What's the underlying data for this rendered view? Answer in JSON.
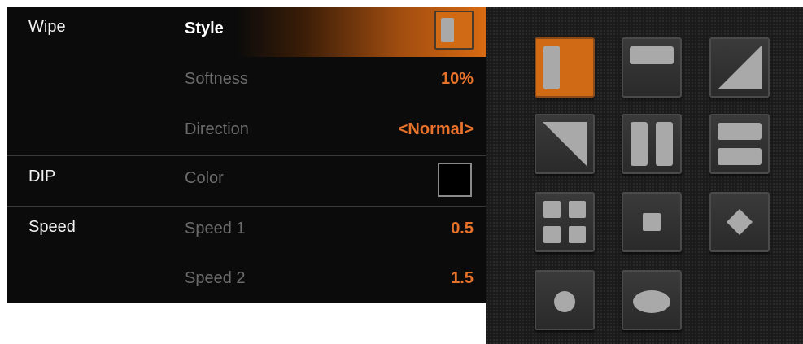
{
  "menu": {
    "rows": [
      {
        "category": "Wipe",
        "param": "Style",
        "value": "",
        "active": true
      },
      {
        "category": "",
        "param": "Softness",
        "value": "10%"
      },
      {
        "category": "",
        "param": "Direction",
        "value": "<Normal>"
      },
      {
        "category": "DIP",
        "param": "Color",
        "value": "",
        "swatch_color": "#000000"
      },
      {
        "category": "Speed",
        "param": "Speed 1",
        "value": "0.5"
      },
      {
        "category": "",
        "param": "Speed 2",
        "value": "1.5"
      }
    ]
  },
  "colors": {
    "accent": "#d06a14",
    "value_text": "#e8722a",
    "panel_bg": "#0b0b0b",
    "pattern_bg": "#1b1b1b",
    "shape": "#a9a9a9"
  },
  "patterns": {
    "selected_index": 0,
    "items": [
      {
        "name": "vertical-bar"
      },
      {
        "name": "horizontal-bar"
      },
      {
        "name": "diagonal-top-right"
      },
      {
        "name": "diagonal-bottom-left"
      },
      {
        "name": "vertical-split"
      },
      {
        "name": "horizontal-split"
      },
      {
        "name": "four-squares"
      },
      {
        "name": "center-square"
      },
      {
        "name": "diamond"
      },
      {
        "name": "circle"
      },
      {
        "name": "ellipse"
      }
    ]
  }
}
